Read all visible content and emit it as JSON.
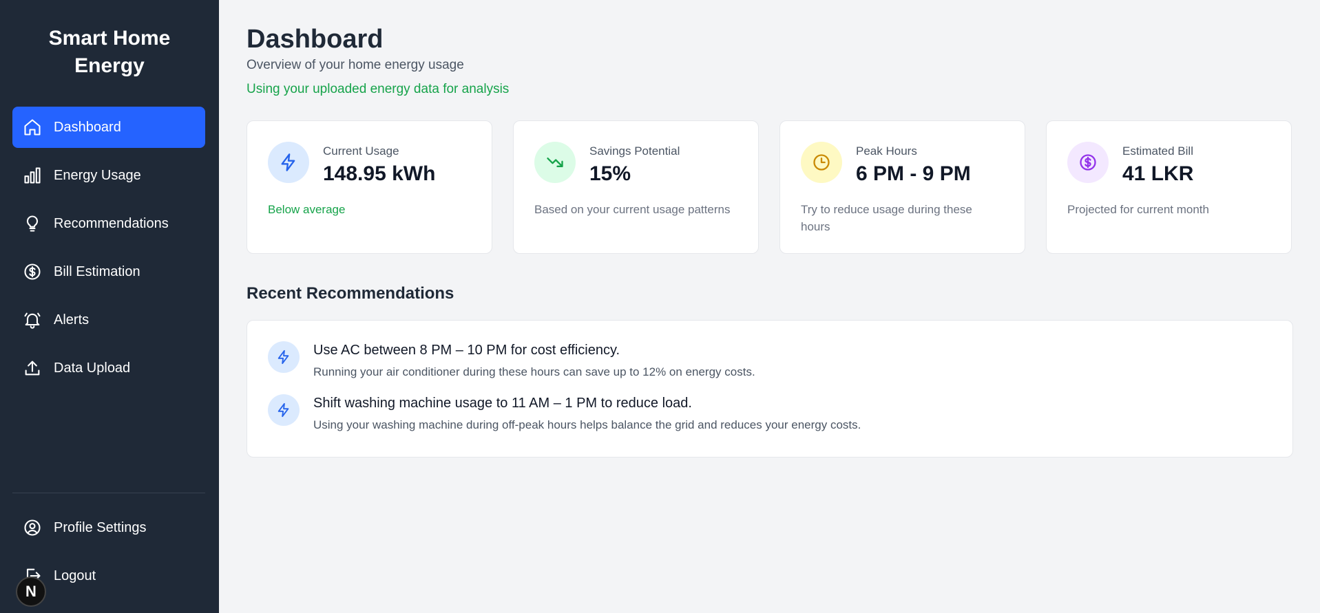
{
  "app": {
    "brand_line1": "Smart Home",
    "brand_line2": "Energy"
  },
  "sidebar": {
    "items": [
      {
        "label": "Dashboard",
        "icon": "home-icon",
        "active": true
      },
      {
        "label": "Energy Usage",
        "icon": "bar-chart-icon"
      },
      {
        "label": "Recommendations",
        "icon": "lightbulb-icon"
      },
      {
        "label": "Bill Estimation",
        "icon": "dollar-circle-icon"
      },
      {
        "label": "Alerts",
        "icon": "bell-icon"
      },
      {
        "label": "Data Upload",
        "icon": "upload-icon"
      }
    ],
    "bottom": [
      {
        "label": "Profile Settings",
        "icon": "user-circle-icon"
      },
      {
        "label": "Logout",
        "icon": "logout-icon"
      }
    ],
    "badge": "N"
  },
  "header": {
    "title": "Dashboard",
    "subtitle": "Overview of your home energy usage",
    "data_note": "Using your uploaded energy data for analysis"
  },
  "cards": [
    {
      "label": "Current Usage",
      "value": "148.95 kWh",
      "note": "Below average",
      "icon": "lightning-icon",
      "color": "#2563eb"
    },
    {
      "label": "Savings Potential",
      "value": "15%",
      "note": "Based on your current usage patterns",
      "icon": "trending-down-icon",
      "color": "#16a34a"
    },
    {
      "label": "Peak Hours",
      "value": "6 PM - 9 PM",
      "note": "Try to reduce usage during these hours",
      "icon": "clock-icon",
      "color": "#ca8a04"
    },
    {
      "label": "Estimated Bill",
      "value": "41 LKR",
      "note": "Projected for current month",
      "icon": "dollar-circle-icon",
      "color": "#9333ea"
    }
  ],
  "recommendations": {
    "title": "Recent Recommendations",
    "items": [
      {
        "title": "Use AC between 8 PM – 10 PM for cost efficiency.",
        "desc": "Running your air conditioner during these hours can save up to 12% on energy costs."
      },
      {
        "title": "Shift washing machine usage to 11 AM – 1 PM to reduce load.",
        "desc": "Using your washing machine during off-peak hours helps balance the grid and reduces your energy costs."
      }
    ]
  },
  "colors": {
    "sidebar_bg": "#1f2937",
    "accent": "#2563ff",
    "success": "#16a34a"
  }
}
